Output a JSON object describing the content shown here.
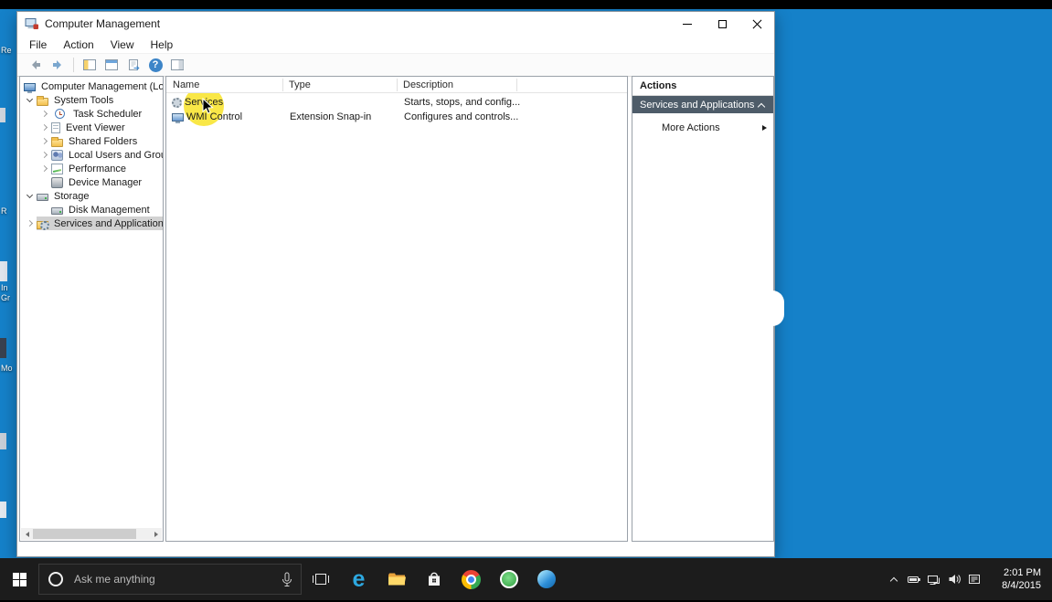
{
  "desktop": {
    "fragments": [
      "Re",
      "R",
      "In",
      "Gr",
      "Mo"
    ]
  },
  "window": {
    "title": "Computer Management",
    "menu": [
      "File",
      "Action",
      "View",
      "Help"
    ]
  },
  "tree": {
    "items": [
      {
        "label": "Computer Management (Local"
      },
      {
        "label": "System Tools"
      },
      {
        "label": "Task Scheduler"
      },
      {
        "label": "Event Viewer"
      },
      {
        "label": "Shared Folders"
      },
      {
        "label": "Local Users and Groups"
      },
      {
        "label": "Performance"
      },
      {
        "label": "Device Manager"
      },
      {
        "label": "Storage"
      },
      {
        "label": "Disk Management"
      },
      {
        "label": "Services and Applications"
      }
    ]
  },
  "list": {
    "columns": [
      "Name",
      "Type",
      "Description"
    ],
    "rows": [
      {
        "name": "Services",
        "type": "",
        "description": "Starts, stops, and config..."
      },
      {
        "name": "WMI Control",
        "type": "Extension Snap-in",
        "description": "Configures and controls..."
      }
    ]
  },
  "actions": {
    "title": "Actions",
    "group": "Services and Applications",
    "more": "More Actions"
  },
  "taskbar": {
    "search_placeholder": "Ask me anything",
    "clock": {
      "time": "2:01 PM",
      "date": "8/4/2015"
    }
  },
  "icons": {
    "edge": "e",
    "help": "?"
  },
  "colors": {
    "desktop": "#1581c9",
    "highlight_yellow": "#f8e433",
    "actions_group_bg": "#4e5c69",
    "taskbar_bg": "#1c1c1c"
  }
}
